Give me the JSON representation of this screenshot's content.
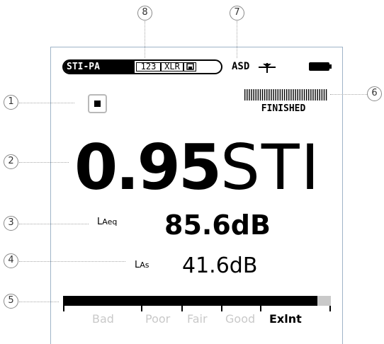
{
  "status_bar": {
    "mode": "STI-PA",
    "channel_segments": [
      "123",
      "XLR"
    ],
    "asd_label": "ASD",
    "icons": [
      "save-icon",
      "antenna-icon",
      "battery-icon"
    ]
  },
  "controls": {
    "stop_icon": "stop-icon"
  },
  "progress": {
    "status": "FINISHED",
    "level": 1.0
  },
  "result": {
    "sti_value": "0.95",
    "sti_unit": "STI"
  },
  "laeq": {
    "label_main": "L",
    "label_sub": "Aeq",
    "value": "85.6dB"
  },
  "las": {
    "label_main": "L",
    "label_sub": "As",
    "value": "41.6dB"
  },
  "rating_scale": {
    "labels": [
      "Bad",
      "Poor",
      "Fair",
      "Good",
      "Exlnt"
    ],
    "active": "Exlnt",
    "fill_fraction": 0.95
  },
  "callouts": [
    "1",
    "2",
    "3",
    "4",
    "5",
    "6",
    "7",
    "8"
  ]
}
